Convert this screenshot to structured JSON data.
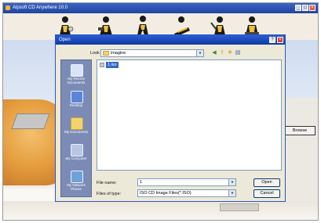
{
  "app": {
    "title": "Alpsoft CD Anywhere 10.0",
    "titlebar_controls": {
      "minimize": "_",
      "maximize": "□",
      "close": "×"
    }
  },
  "toolbar": {
    "icons": [
      "person-disc-icon",
      "person-tools-icon",
      "person-walking-icon",
      "person-drive-icon",
      "person-wrench-icon",
      "person-sitting-icon"
    ]
  },
  "background_panel": {
    "browse_label": "Browse"
  },
  "dialog": {
    "title": "Open",
    "help_button": "?",
    "close_button": "×",
    "look_in_label": "Look in:",
    "look_in_value": "imagine",
    "nav_icons": [
      "back-icon",
      "up-folder-icon",
      "new-folder-icon",
      "view-menu-icon"
    ],
    "places": [
      {
        "label": "My Recent Documents",
        "icon": "recent-documents-icon"
      },
      {
        "label": "Desktop",
        "icon": "desktop-icon"
      },
      {
        "label": "My Documents",
        "icon": "my-documents-icon"
      },
      {
        "label": "My Computer",
        "icon": "my-computer-icon"
      },
      {
        "label": "My Network Places",
        "icon": "network-places-icon"
      }
    ],
    "files": [
      {
        "name": "1.iso",
        "selected": true
      }
    ],
    "file_name_label": "File name:",
    "file_name_value": "1",
    "file_type_label": "Files of type:",
    "file_type_value": "ISO CD Image Files(*.ISO)",
    "open_button": "Open",
    "cancel_button": "Cancel"
  },
  "colors": {
    "titlebar": "#2a5cd8",
    "places_bar": "#7b8bb6",
    "selection": "#316ac5",
    "dialog_bg": "#ece9d8"
  }
}
